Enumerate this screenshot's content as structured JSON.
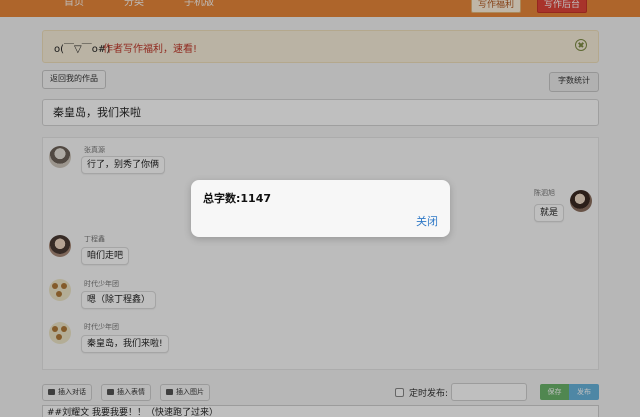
{
  "nav": {
    "items": [
      "首页",
      "分类",
      "手机版"
    ]
  },
  "top_buttons": {
    "welfare": "写作福利",
    "backend": "写作后台"
  },
  "alert": {
    "kaomoji": "o(￣▽￣o#)",
    "text": "作者写作福利，速看!"
  },
  "buttons": {
    "back": "返回我的作品",
    "word_count": "字数统计"
  },
  "title_input": {
    "value": "秦皇岛，我们来啦"
  },
  "messages": [
    {
      "name": "张真源",
      "text": "行了，别秀了你俩",
      "side": "left"
    },
    {
      "name": "陈泗旭",
      "text": "就是",
      "side": "right"
    },
    {
      "name": "丁程鑫",
      "text": "咱们走吧",
      "side": "left"
    },
    {
      "name": "时代少年团",
      "text": "嗯（除丁程鑫）",
      "side": "left"
    },
    {
      "name": "时代少年团",
      "text": "秦皇岛，我们来啦!",
      "side": "left"
    }
  ],
  "toolbar": {
    "insert_dialog": "插入对话",
    "insert_emoji": "插入表情",
    "insert_image": "插入图片",
    "schedule_label": "定时发布:",
    "save": "保存",
    "publish": "发布"
  },
  "content": {
    "text": "##刘耀文 我要我要！！（快速跑了过来）"
  },
  "modal": {
    "title": "总字数:1147",
    "close": "关闭"
  },
  "colors": {
    "accent": "#e8873a",
    "link": "#2f79c7",
    "save": "#6bb56b",
    "publish": "#69b4dd"
  }
}
